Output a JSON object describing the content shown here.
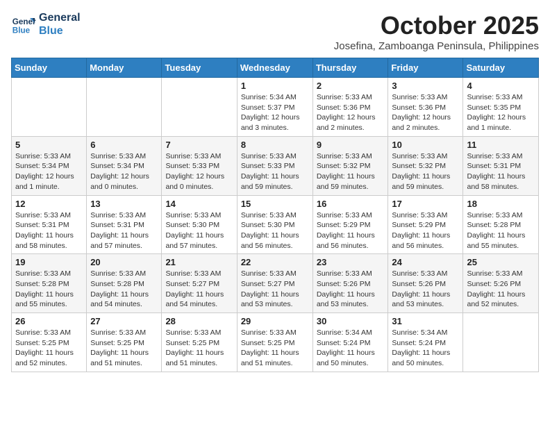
{
  "logo": {
    "line1": "General",
    "line2": "Blue"
  },
  "header": {
    "month": "October 2025",
    "location": "Josefina, Zamboanga Peninsula, Philippines"
  },
  "weekdays": [
    "Sunday",
    "Monday",
    "Tuesday",
    "Wednesday",
    "Thursday",
    "Friday",
    "Saturday"
  ],
  "weeks": [
    [
      {
        "day": "",
        "info": ""
      },
      {
        "day": "",
        "info": ""
      },
      {
        "day": "",
        "info": ""
      },
      {
        "day": "1",
        "info": "Sunrise: 5:34 AM\nSunset: 5:37 PM\nDaylight: 12 hours and 3 minutes."
      },
      {
        "day": "2",
        "info": "Sunrise: 5:33 AM\nSunset: 5:36 PM\nDaylight: 12 hours and 2 minutes."
      },
      {
        "day": "3",
        "info": "Sunrise: 5:33 AM\nSunset: 5:36 PM\nDaylight: 12 hours and 2 minutes."
      },
      {
        "day": "4",
        "info": "Sunrise: 5:33 AM\nSunset: 5:35 PM\nDaylight: 12 hours and 1 minute."
      }
    ],
    [
      {
        "day": "5",
        "info": "Sunrise: 5:33 AM\nSunset: 5:34 PM\nDaylight: 12 hours and 1 minute."
      },
      {
        "day": "6",
        "info": "Sunrise: 5:33 AM\nSunset: 5:34 PM\nDaylight: 12 hours and 0 minutes."
      },
      {
        "day": "7",
        "info": "Sunrise: 5:33 AM\nSunset: 5:33 PM\nDaylight: 12 hours and 0 minutes."
      },
      {
        "day": "8",
        "info": "Sunrise: 5:33 AM\nSunset: 5:33 PM\nDaylight: 11 hours and 59 minutes."
      },
      {
        "day": "9",
        "info": "Sunrise: 5:33 AM\nSunset: 5:32 PM\nDaylight: 11 hours and 59 minutes."
      },
      {
        "day": "10",
        "info": "Sunrise: 5:33 AM\nSunset: 5:32 PM\nDaylight: 11 hours and 59 minutes."
      },
      {
        "day": "11",
        "info": "Sunrise: 5:33 AM\nSunset: 5:31 PM\nDaylight: 11 hours and 58 minutes."
      }
    ],
    [
      {
        "day": "12",
        "info": "Sunrise: 5:33 AM\nSunset: 5:31 PM\nDaylight: 11 hours and 58 minutes."
      },
      {
        "day": "13",
        "info": "Sunrise: 5:33 AM\nSunset: 5:31 PM\nDaylight: 11 hours and 57 minutes."
      },
      {
        "day": "14",
        "info": "Sunrise: 5:33 AM\nSunset: 5:30 PM\nDaylight: 11 hours and 57 minutes."
      },
      {
        "day": "15",
        "info": "Sunrise: 5:33 AM\nSunset: 5:30 PM\nDaylight: 11 hours and 56 minutes."
      },
      {
        "day": "16",
        "info": "Sunrise: 5:33 AM\nSunset: 5:29 PM\nDaylight: 11 hours and 56 minutes."
      },
      {
        "day": "17",
        "info": "Sunrise: 5:33 AM\nSunset: 5:29 PM\nDaylight: 11 hours and 56 minutes."
      },
      {
        "day": "18",
        "info": "Sunrise: 5:33 AM\nSunset: 5:28 PM\nDaylight: 11 hours and 55 minutes."
      }
    ],
    [
      {
        "day": "19",
        "info": "Sunrise: 5:33 AM\nSunset: 5:28 PM\nDaylight: 11 hours and 55 minutes."
      },
      {
        "day": "20",
        "info": "Sunrise: 5:33 AM\nSunset: 5:28 PM\nDaylight: 11 hours and 54 minutes."
      },
      {
        "day": "21",
        "info": "Sunrise: 5:33 AM\nSunset: 5:27 PM\nDaylight: 11 hours and 54 minutes."
      },
      {
        "day": "22",
        "info": "Sunrise: 5:33 AM\nSunset: 5:27 PM\nDaylight: 11 hours and 53 minutes."
      },
      {
        "day": "23",
        "info": "Sunrise: 5:33 AM\nSunset: 5:26 PM\nDaylight: 11 hours and 53 minutes."
      },
      {
        "day": "24",
        "info": "Sunrise: 5:33 AM\nSunset: 5:26 PM\nDaylight: 11 hours and 53 minutes."
      },
      {
        "day": "25",
        "info": "Sunrise: 5:33 AM\nSunset: 5:26 PM\nDaylight: 11 hours and 52 minutes."
      }
    ],
    [
      {
        "day": "26",
        "info": "Sunrise: 5:33 AM\nSunset: 5:25 PM\nDaylight: 11 hours and 52 minutes."
      },
      {
        "day": "27",
        "info": "Sunrise: 5:33 AM\nSunset: 5:25 PM\nDaylight: 11 hours and 51 minutes."
      },
      {
        "day": "28",
        "info": "Sunrise: 5:33 AM\nSunset: 5:25 PM\nDaylight: 11 hours and 51 minutes."
      },
      {
        "day": "29",
        "info": "Sunrise: 5:33 AM\nSunset: 5:25 PM\nDaylight: 11 hours and 51 minutes."
      },
      {
        "day": "30",
        "info": "Sunrise: 5:34 AM\nSunset: 5:24 PM\nDaylight: 11 hours and 50 minutes."
      },
      {
        "day": "31",
        "info": "Sunrise: 5:34 AM\nSunset: 5:24 PM\nDaylight: 11 hours and 50 minutes."
      },
      {
        "day": "",
        "info": ""
      }
    ]
  ]
}
